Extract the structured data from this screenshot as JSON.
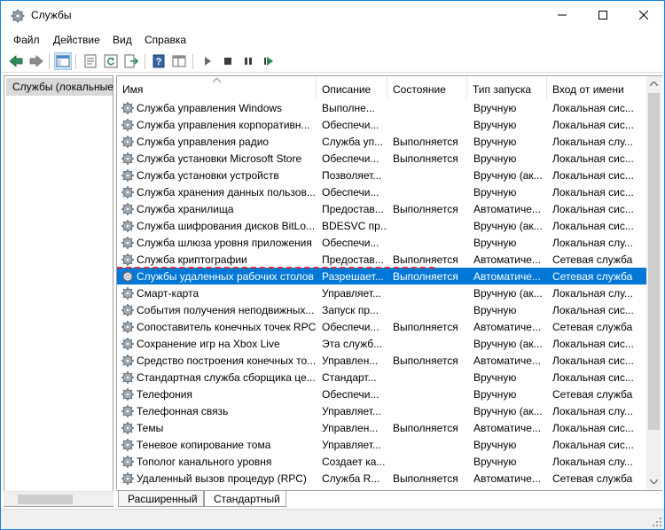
{
  "window": {
    "title": "Службы"
  },
  "menu": [
    "Файл",
    "Действие",
    "Вид",
    "Справка"
  ],
  "toolbar": {
    "buttons": [
      "back-arrow-icon",
      "forward-arrow-icon",
      "show-hide-tree-icon",
      "properties-icon",
      "refresh-icon",
      "export-list-icon",
      "help-icon",
      "view-icon",
      "start-service-icon",
      "stop-service-icon",
      "pause-service-icon",
      "restart-service-icon"
    ]
  },
  "tree": {
    "root_label": "Службы (локальные)"
  },
  "columns": {
    "name": "Имя",
    "description": "Описание",
    "state": "Состояние",
    "startup": "Тип запуска",
    "logon": "Вход от имени"
  },
  "services": [
    {
      "name": "Служба управления Windows",
      "description": "Выполне...",
      "state": "",
      "startup": "Вручную",
      "logon": "Локальная сис..."
    },
    {
      "name": "Служба управления корпоративн...",
      "description": "Обеспечи...",
      "state": "",
      "startup": "Вручную",
      "logon": "Локальная сис..."
    },
    {
      "name": "Служба управления радио",
      "description": "Служба уп...",
      "state": "Выполняется",
      "startup": "Вручную",
      "logon": "Локальная слу..."
    },
    {
      "name": "Служба установки Microsoft Store",
      "description": "Обеспечи...",
      "state": "Выполняется",
      "startup": "Вручную",
      "logon": "Локальная сис..."
    },
    {
      "name": "Служба установки устройств",
      "description": "Позволяет...",
      "state": "",
      "startup": "Вручную (ак...",
      "logon": "Локальная сис..."
    },
    {
      "name": "Служба хранения данных пользов...",
      "description": "Обеспечи...",
      "state": "",
      "startup": "Вручную",
      "logon": "Локальная сис..."
    },
    {
      "name": "Служба хранилища",
      "description": "Предостав...",
      "state": "Выполняется",
      "startup": "Автоматиче...",
      "logon": "Локальная сис..."
    },
    {
      "name": "Служба шифрования дисков BitLo...",
      "description": "BDESVC пр...",
      "state": "",
      "startup": "Вручную (ак...",
      "logon": "Локальная сис..."
    },
    {
      "name": "Служба шлюза уровня приложения",
      "description": "Обеспечи...",
      "state": "",
      "startup": "Вручную",
      "logon": "Локальная слу..."
    },
    {
      "name": "Служба криптографии",
      "description": "Предостав...",
      "state": "Выполняется",
      "startup": "Автоматиче...",
      "logon": "Сетевая служба"
    },
    {
      "name": "Службы удаленных рабочих столов",
      "description": "Разрешает...",
      "state": "Выполняется",
      "startup": "Автоматиче...",
      "logon": "Сетевая служба",
      "selected": true
    },
    {
      "name": "Смарт-карта",
      "description": "Управляет...",
      "state": "",
      "startup": "Вручную (ак...",
      "logon": "Локальная слу..."
    },
    {
      "name": "События получения неподвижных...",
      "description": "Запуск пр...",
      "state": "",
      "startup": "Вручную",
      "logon": "Локальная сис..."
    },
    {
      "name": "Сопоставитель конечных точек RPC",
      "description": "Обеспечи...",
      "state": "Выполняется",
      "startup": "Автоматиче...",
      "logon": "Сетевая служба"
    },
    {
      "name": "Сохранение игр на Xbox Live",
      "description": "Эта служб...",
      "state": "",
      "startup": "Вручную (ак...",
      "logon": "Локальная сис..."
    },
    {
      "name": "Средство построения конечных то...",
      "description": "Управлен...",
      "state": "Выполняется",
      "startup": "Автоматиче...",
      "logon": "Локальная сис..."
    },
    {
      "name": "Стандартная служба сборщика це...",
      "description": "Стандарт...",
      "state": "",
      "startup": "Вручную",
      "logon": "Локальная сис..."
    },
    {
      "name": "Телефония",
      "description": "Обеспечи...",
      "state": "",
      "startup": "Вручную",
      "logon": "Сетевая служба"
    },
    {
      "name": "Телефонная связь",
      "description": "Управляет...",
      "state": "",
      "startup": "Вручную (ак...",
      "logon": "Локальная слу..."
    },
    {
      "name": "Темы",
      "description": "Управлен...",
      "state": "Выполняется",
      "startup": "Автоматиче...",
      "logon": "Локальная сис..."
    },
    {
      "name": "Теневое копирование тома",
      "description": "Управляет...",
      "state": "",
      "startup": "Вручную",
      "logon": "Локальная сис..."
    },
    {
      "name": "Тополог канального уровня",
      "description": "Создает ка...",
      "state": "",
      "startup": "Вручную",
      "logon": "Локальная слу..."
    },
    {
      "name": "Удаленный вызов процедур (RPC)",
      "description": "Служба R...",
      "state": "Выполняется",
      "startup": "Автоматиче...",
      "logon": "Сетевая служба"
    }
  ],
  "tabs": [
    "Расширенный",
    "Стандартный"
  ],
  "scroll": {
    "list_thumb_fraction": 0.88
  },
  "colors": {
    "selection": "#0078d7",
    "accent_border": "#1883d7",
    "annotation_dash": "#e0322e"
  }
}
